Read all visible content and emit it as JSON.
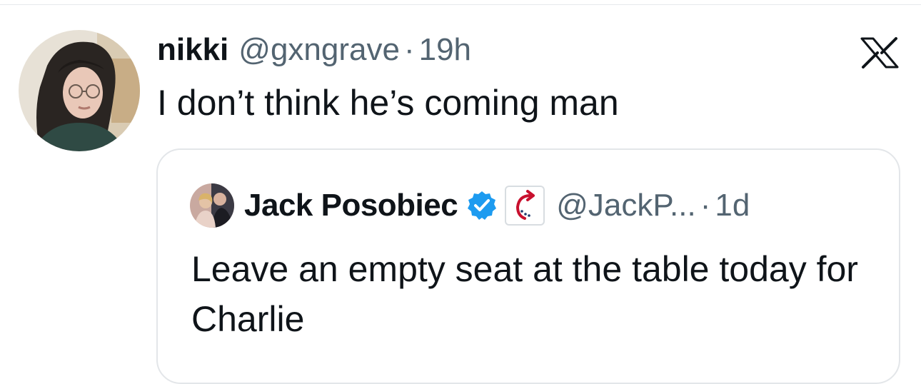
{
  "tweet": {
    "display_name": "nikki",
    "handle": "@gxngrave",
    "separator": "·",
    "time": "19h",
    "text": "I don’t think he’s coming man",
    "icons": {
      "avatar": "profile-photo",
      "brand": "x-logo-icon"
    }
  },
  "quote": {
    "display_name": "Jack Posobiec",
    "handle": "@JackP...",
    "separator": "·",
    "time": "1d",
    "text": "Leave an empty seat at the table today for Charlie",
    "icons": {
      "verified": "verified-badge-icon",
      "affiliation": "affiliation-badge-icon"
    }
  },
  "colors": {
    "text_primary": "#0f1419",
    "text_secondary": "#536471",
    "verified_blue": "#1d9bf0",
    "affiliation_red": "#c8102e",
    "affiliation_navy": "#1f3a6e",
    "border": "#e3e6e9"
  }
}
